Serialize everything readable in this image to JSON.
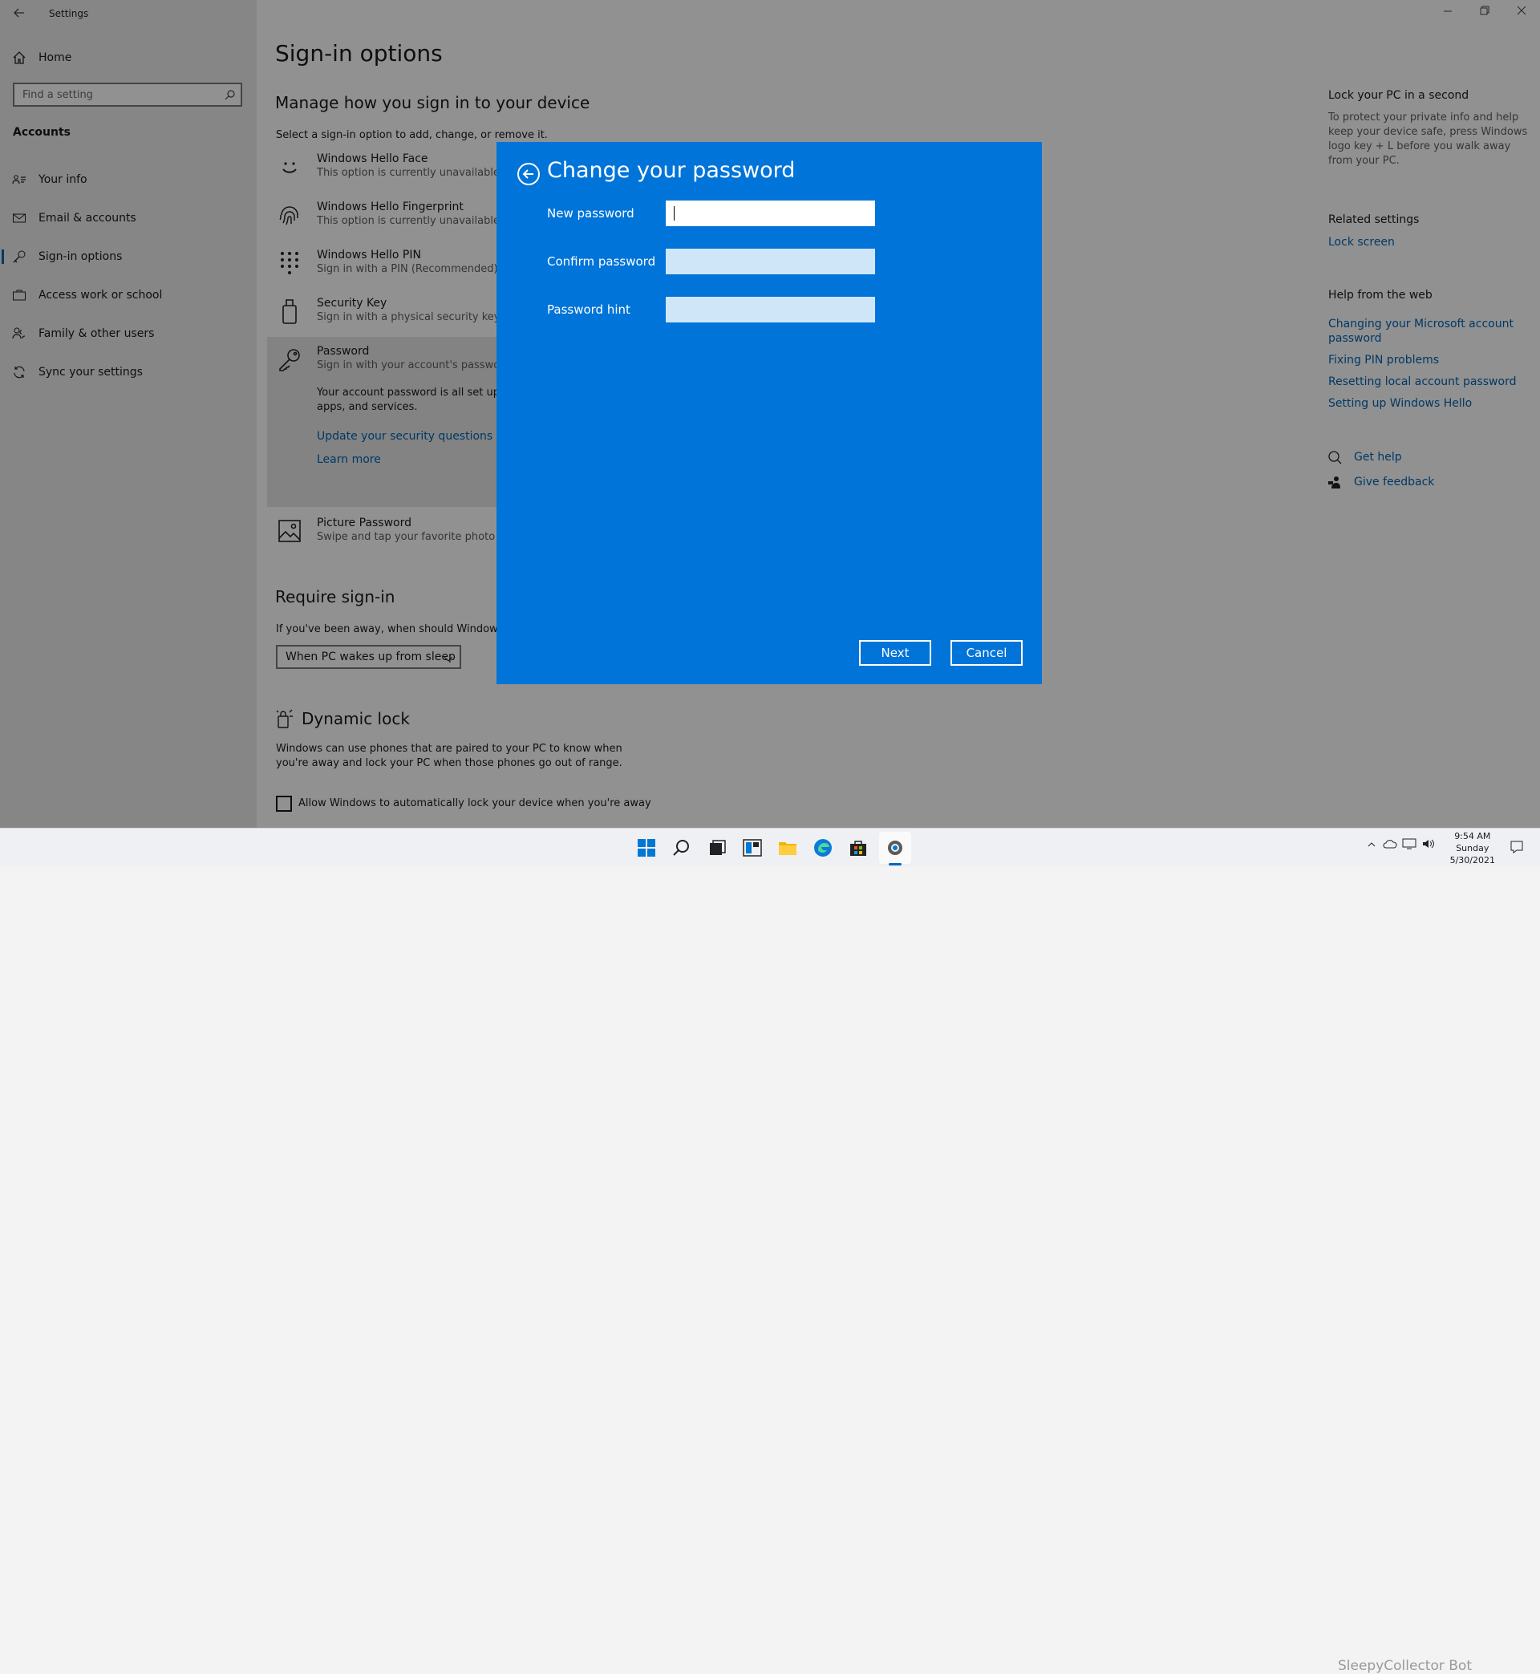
{
  "window": {
    "title": "Settings",
    "back_icon": "arrow-left-icon",
    "controls": [
      "minimize-icon",
      "restore-icon",
      "close-icon"
    ]
  },
  "sidebar": {
    "home": "Home",
    "search_placeholder": "Find a setting",
    "section": "Accounts",
    "items": [
      {
        "label": "Your info",
        "icon": "contact-card-icon"
      },
      {
        "label": "Email & accounts",
        "icon": "mail-icon"
      },
      {
        "label": "Sign-in options",
        "icon": "key-icon",
        "selected": true
      },
      {
        "label": "Access work or school",
        "icon": "briefcase-icon"
      },
      {
        "label": "Family & other users",
        "icon": "people-icon"
      },
      {
        "label": "Sync your settings",
        "icon": "sync-icon"
      }
    ]
  },
  "main": {
    "title": "Sign-in options",
    "subtitle": "Manage how you sign in to your device",
    "instruction": "Select a sign-in option to add, change, or remove it.",
    "options": [
      {
        "title": "Windows Hello Face",
        "desc": "This option is currently unavailable—",
        "icon": "face-icon"
      },
      {
        "title": "Windows Hello Fingerprint",
        "desc": "This option is currently unavailable—",
        "icon": "fingerprint-icon"
      },
      {
        "title": "Windows Hello PIN",
        "desc": "Sign in with a PIN (Recommended)",
        "icon": "keypad-icon"
      },
      {
        "title": "Security Key",
        "desc": "Sign in with a physical security key",
        "icon": "usb-key-icon"
      },
      {
        "title": "Password",
        "desc": "Sign in with your account's password",
        "icon": "key-icon"
      },
      {
        "title": "Picture Password",
        "desc": "Swipe and tap your favorite photo to",
        "icon": "picture-icon"
      }
    ],
    "password_detail": "Your account password is all set up to",
    "password_detail2": "apps, and services.",
    "update_link": "Update your security questions",
    "learn_more": "Learn more",
    "require_heading": "Require sign-in",
    "require_text": "If you've been away, when should Windows r",
    "require_select": "When PC wakes up from sleep",
    "dynamic_heading": "Dynamic lock",
    "dynamic_text1": "Windows can use phones that are paired to your PC to know when",
    "dynamic_text2": "you're away and lock your PC when those phones go out of range.",
    "dynamic_checkbox": "Allow Windows to automatically lock your device when you're away"
  },
  "right": {
    "lock_heading": "Lock your PC in a second",
    "lock_text": [
      "To protect your private info and help",
      "keep your device safe, press Windows",
      "logo key + L before you walk away",
      "from your PC."
    ],
    "related_heading": "Related settings",
    "related_link": "Lock screen",
    "help_heading": "Help from the web",
    "help_links": [
      "Changing your Microsoft account",
      "password",
      "Fixing PIN problems",
      "Resetting local account password",
      "Setting up Windows Hello"
    ],
    "get_help": "Get help",
    "give_feedback": "Give feedback"
  },
  "dialog": {
    "title": "Change your password",
    "new_password_label": "New password",
    "confirm_password_label": "Confirm password",
    "hint_label": "Password hint",
    "new_password_value": "",
    "confirm_password_value": "",
    "hint_value": "",
    "next": "Next",
    "cancel": "Cancel"
  },
  "taskbar": {
    "icons": [
      "windows-start-icon",
      "search-icon",
      "task-view-icon",
      "widgets-icon",
      "file-explorer-icon",
      "edge-icon",
      "store-icon",
      "settings-icon"
    ],
    "time": "9:54 AM",
    "day": "Sunday",
    "date": "5/30/2021",
    "tray": [
      "chevron-up-icon",
      "cloud-icon",
      "network-icon",
      "volume-icon",
      "notification-icon"
    ]
  },
  "watermark": "SleepyCollector Bot"
}
